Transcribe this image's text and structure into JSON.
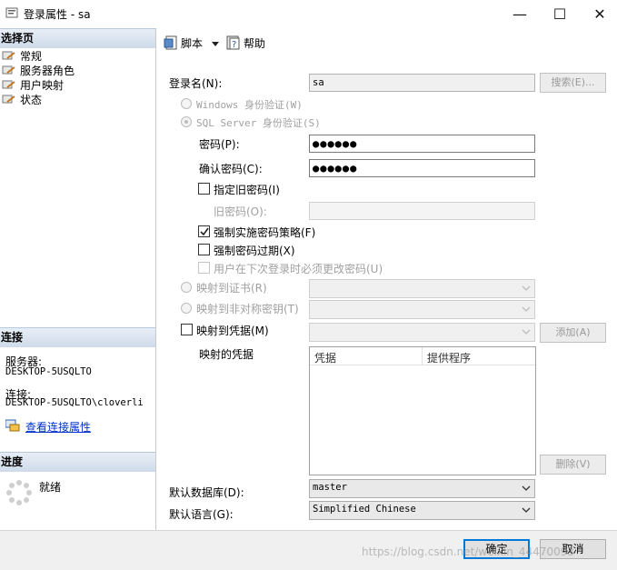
{
  "window": {
    "title": "登录属性 - sa",
    "controls": {
      "minimize": "—",
      "maximize": "☐",
      "close": "✕"
    }
  },
  "left": {
    "select_page_header": "选择页",
    "pages": [
      "常规",
      "服务器角色",
      "用户映射",
      "状态"
    ],
    "connection_header": "连接",
    "server_label": "服务器:",
    "server_value": "DESKTOP-5USQLTO",
    "connection_label": "连接:",
    "connection_value": "DESKTOP-5USQLTO\\cloverli",
    "view_conn_props": "查看连接属性",
    "progress_header": "进度",
    "progress_status": "就绪"
  },
  "toolbar": {
    "script": "脚本",
    "help": "帮助"
  },
  "form": {
    "login_name_label": "登录名(N):",
    "login_name_value": "sa",
    "search_button": "搜索(E)...",
    "windows_auth": "Windows 身份验证(W)",
    "sql_auth": "SQL Server 身份验证(S)",
    "password_label": "密码(P):",
    "password_value": "●●●●●●",
    "confirm_label": "确认密码(C):",
    "confirm_value": "●●●●●●",
    "specify_old": "指定旧密码(I)",
    "old_password_label": "旧密码(O):",
    "enforce_policy": "强制实施密码策略(F)",
    "enforce_expiration": "强制密码过期(X)",
    "must_change": "用户在下次登录时必须更改密码(U)",
    "map_cert": "映射到证书(R)",
    "map_asym": "映射到非对称密钥(T)",
    "map_cred": "映射到凭据(M)",
    "add_button": "添加(A)",
    "mapped_cred_label": "映射的凭据",
    "cred_columns": [
      "凭据",
      "提供程序"
    ],
    "remove_button": "删除(V)",
    "default_db_label": "默认数据库(D):",
    "default_db_value": "master",
    "default_lang_label": "默认语言(G):",
    "default_lang_value": "Simplified Chinese"
  },
  "footer": {
    "ok": "确定",
    "cancel": "取消",
    "watermark": "https://blog.csdn.net/weixin_44470093"
  },
  "colors": {
    "accent": "#0078d7",
    "link": "#0033cc",
    "section_header": "#cfdbea"
  }
}
